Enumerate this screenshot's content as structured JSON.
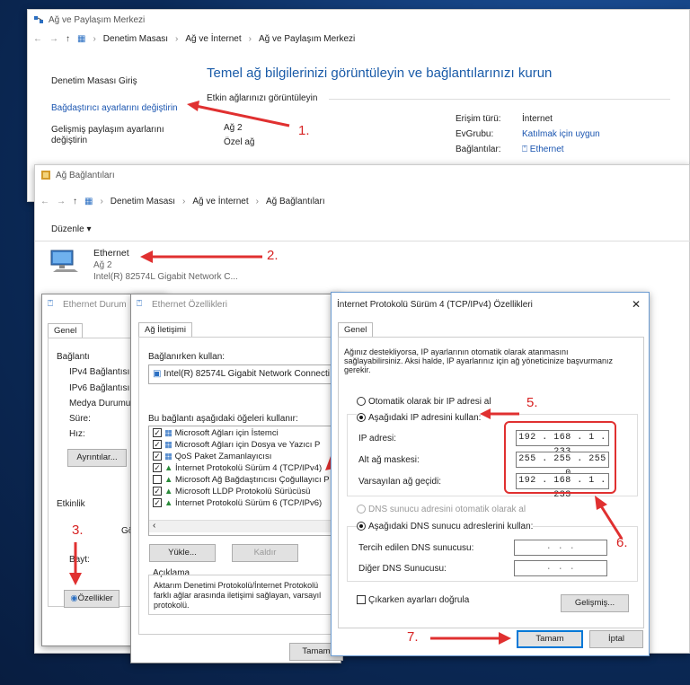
{
  "win1": {
    "title": "Ağ ve Paylaşım Merkezi",
    "breadcrumb": [
      "Denetim Masası",
      "Ağ ve İnternet",
      "Ağ ve Paylaşım Merkezi"
    ],
    "sidebar": [
      "Denetim Masası Giriş",
      "Bağdaştırıcı ayarlarını değiştirin",
      "Gelişmiş paylaşım ayarlarını",
      "değiştirin"
    ],
    "heading": "Temel ağ bilgilerinizi görüntüleyin ve bağlantılarınızı kurun",
    "active_label": "Etkin ağlarınızı görüntüleyin",
    "network_name": "Ağ 2",
    "network_type": "Özel ağ",
    "access_type_label": "Erişim türü:",
    "access_type_value": "İnternet",
    "homegroup_label": "EvGrubu:",
    "homegroup_value": "Katılmak için uygun",
    "connections_label": "Bağlantılar:",
    "connections_value": "Ethernet"
  },
  "win2": {
    "title": "Ağ Bağlantıları",
    "breadcrumb": [
      "Denetim Masası",
      "Ağ ve İnternet",
      "Ağ Bağlantıları"
    ],
    "organize": "Düzenle ▾",
    "adapter_name": "Ethernet",
    "adapter_network": "Ağ 2",
    "adapter_device": "Intel(R) 82574L Gigabit Network C..."
  },
  "win3": {
    "title": "Ethernet Durum",
    "tab": "Genel",
    "section_connection": "Bağlantı",
    "rows": [
      "IPv4 Bağlantısı:",
      "IPv6 Bağlantısı:",
      "Medya Durumu:",
      "Süre:",
      "Hız:"
    ],
    "details_button": "Ayrıntılar...",
    "section_activity": "Etkinlik",
    "sent_short": "Gö",
    "bytes_label": "Bayt:",
    "properties_button": "Özellikler"
  },
  "win4": {
    "title": "Ethernet Özellikleri",
    "tab": "Ağ İletişimi",
    "connect_using": "Bağlanırken kullan:",
    "adapter": "Intel(R) 82574L Gigabit Network Connecti",
    "items_label": "Bu bağlantı aşağıdaki öğeleri kullanır:",
    "items": [
      {
        "label": "Microsoft Ağları için İstemci",
        "checked": true
      },
      {
        "label": "Microsoft Ağları için Dosya ve Yazıcı P",
        "checked": true
      },
      {
        "label": "QoS Paket Zamanlayıcısı",
        "checked": true
      },
      {
        "label": "İnternet Protokolü Sürüm 4 (TCP/IPv4)",
        "checked": true
      },
      {
        "label": "Microsoft Ağ Bağdaştırıcısı Çoğullayıcı P",
        "checked": false
      },
      {
        "label": "Microsoft LLDP Protokolü Sürücüsü",
        "checked": true
      },
      {
        "label": "İnternet Protokolü Sürüm 6 (TCP/IPv6)",
        "checked": true
      }
    ],
    "install_button": "Yükle...",
    "remove_button": "Kaldır",
    "description_label": "Açıklama",
    "description": [
      "Aktarım Denetimi Protokolü/İnternet Protokolü",
      "farklı ağlar arasında iletişimi sağlayan, varsayıl",
      "protokolü."
    ],
    "ok_button": "Tamam"
  },
  "win5": {
    "title": "İnternet Protokolü Sürüm 4 (TCP/IPv4) Özellikleri",
    "close": "✕",
    "tab": "Genel",
    "intro": [
      "Ağınız destekliyorsa, IP ayarlarının otomatik olarak atanmasını",
      "sağlayabilirsiniz. Aksi halde, IP ayarlarınız için ağ yöneticinize başvurmanız",
      "gerekir."
    ],
    "auto_ip": "Otomatik olarak bir IP adresi al",
    "manual_ip": "Aşağıdaki IP adresini kullan:",
    "ip_label": "IP adresi:",
    "ip_value": "192 . 168 .  1  . 233",
    "mask_label": "Alt ağ maskesi:",
    "mask_value": "255 . 255 . 255 .  0",
    "gateway_label": "Varsayılan ağ geçidi:",
    "gateway_value": "192 . 168 .  1  . 233",
    "auto_dns": "DNS sunucu adresini otomatik olarak al",
    "manual_dns": "Aşağıdaki DNS sunucu adreslerini kullan:",
    "pref_dns_label": "Tercih edilen DNS sunucusu:",
    "alt_dns_label": "Diğer DNS Sunucusu:",
    "empty_ip": ".      .      .",
    "validate": "Çıkarken ayarları doğrula",
    "advanced_button": "Gelişmiş...",
    "ok_button": "Tamam",
    "cancel_button": "İptal"
  },
  "annotations": [
    "1.",
    "2.",
    "3.",
    "4.",
    "5.",
    "6.",
    "7."
  ],
  "colors": {
    "annotation": "#e03030",
    "link": "#1a55b0",
    "heading": "#1a5ba8"
  }
}
